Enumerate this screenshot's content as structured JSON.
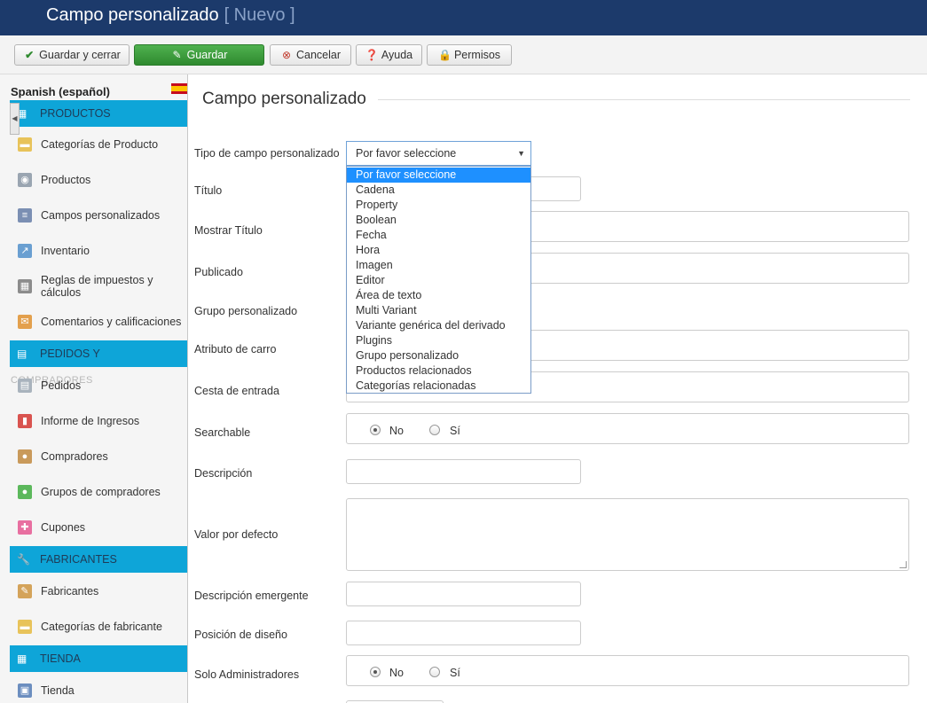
{
  "header": {
    "title": "Campo personalizado",
    "subtitle": "[ Nuevo ]"
  },
  "toolbar": {
    "save_close": "Guardar y cerrar",
    "save": "Guardar",
    "cancel": "Cancelar",
    "help": "Ayuda",
    "permissions": "Permisos"
  },
  "sidebar": {
    "language": "Spanish (español)",
    "sections": {
      "productos": "PRODUCTOS",
      "pedidos": "PEDIDOS Y",
      "pedidos_ghost": "COMPRADORES",
      "fabricantes": "FABRICANTES",
      "tienda": "TIENDA"
    },
    "items": [
      {
        "label": "Categorías de Producto",
        "icon": "folder-icon"
      },
      {
        "label": "Productos",
        "icon": "camera-icon"
      },
      {
        "label": "Campos personalizados",
        "icon": "form-icon"
      },
      {
        "label": "Inventario",
        "icon": "chart-icon"
      },
      {
        "label": "Reglas de impuestos y cálculos",
        "icon": "calculator-icon"
      },
      {
        "label": "Comentarios y calificaciones",
        "icon": "comment-icon"
      },
      {
        "label": "Pedidos",
        "icon": "orders-icon"
      },
      {
        "label": "Informe de Ingresos",
        "icon": "bar-chart-icon"
      },
      {
        "label": "Compradores",
        "icon": "users-icon"
      },
      {
        "label": "Grupos de compradores",
        "icon": "groups-icon"
      },
      {
        "label": "Cupones",
        "icon": "gift-icon"
      },
      {
        "label": "Fabricantes",
        "icon": "wrench-icon"
      },
      {
        "label": "Categorías de fabricante",
        "icon": "folder-icon"
      },
      {
        "label": "Tienda",
        "icon": "store-icon"
      }
    ]
  },
  "form": {
    "legend": "Campo personalizado",
    "labels": {
      "type": "Tipo de campo personalizado",
      "title": "Título",
      "show_title": "Mostrar Título",
      "published": "Publicado",
      "group": "Grupo personalizado",
      "cart_attribute": "Atributo de carro",
      "cart_input": "Cesta de entrada",
      "searchable": "Searchable",
      "description": "Descripción",
      "default_value": "Valor por defecto",
      "tooltip": "Descripción emergente",
      "layout_position": "Posición de diseño",
      "admin_only": "Solo Administradores"
    },
    "select_value": "Por favor seleccione",
    "options": [
      "Por favor seleccione",
      "Cadena",
      "Property",
      "Boolean",
      "Fecha",
      "Hora",
      "Imagen",
      "Editor",
      "Área de texto",
      "Multi Variant",
      "Variante genérica del derivado",
      "Plugins",
      "Grupo personalizado",
      "Productos relacionados",
      "Categorías relacionadas"
    ],
    "radio_no": "No",
    "radio_yes": "Sí"
  },
  "colors": {
    "header_bg": "#1c3a6b",
    "sidebar_section": "#0ea5d8",
    "save_button": "#3a9a3a",
    "selected_option": "#1e90ff"
  }
}
